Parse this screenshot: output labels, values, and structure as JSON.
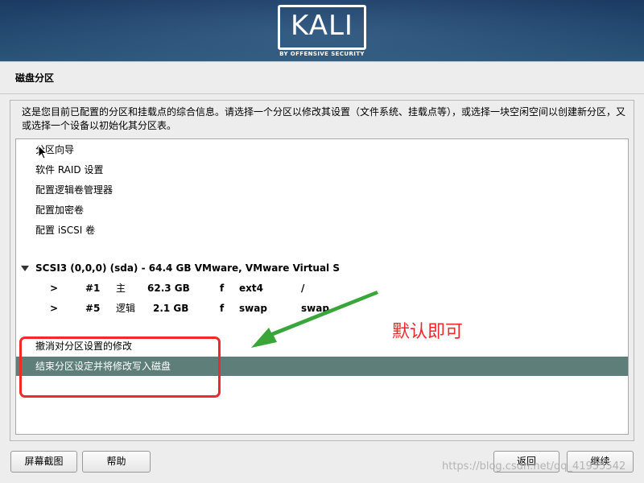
{
  "banner": {
    "logo_text": "KALI",
    "logo_subtitle": "BY OFFENSIVE SECURITY"
  },
  "page": {
    "title": "磁盘分区",
    "description": "这是您目前已配置的分区和挂载点的综合信息。请选择一个分区以修改其设置（文件系统、挂载点等），或选择一块空闲空间以创建新分区，又或选择一个设备以初始化其分区表。"
  },
  "list": {
    "menu_items": [
      "分区向导",
      "软件 RAID 设置",
      "配置逻辑卷管理器",
      "配置加密卷",
      "配置 iSCSI 卷"
    ],
    "disk": {
      "label": "SCSI3 (0,0,0) (sda) - 64.4 GB VMware, VMware Virtual S",
      "partitions": [
        {
          "marker": ">",
          "number": "#1",
          "type": "主",
          "size": "62.3 GB",
          "flag": "f",
          "fs": "ext4",
          "mount": "/"
        },
        {
          "marker": ">",
          "number": "#5",
          "type": "逻辑",
          "size": "2.1 GB",
          "flag": "f",
          "fs": "swap",
          "mount": "swap"
        }
      ]
    },
    "actions": [
      "撤消对分区设置的修改",
      "结束分区设定并将修改写入磁盘"
    ],
    "selected_index": 1
  },
  "annotation": {
    "text": "默认即可",
    "color": "#ef2a2a",
    "arrow_color": "#3aa63a"
  },
  "buttons": {
    "screenshot": "屏幕截图",
    "help": "帮助",
    "back": "返回",
    "continue": "继续"
  },
  "watermark": "https://blog.csdn.net/qq_41955542",
  "colors": {
    "selected_row": "#5e7f79",
    "banner": "#23496f"
  }
}
